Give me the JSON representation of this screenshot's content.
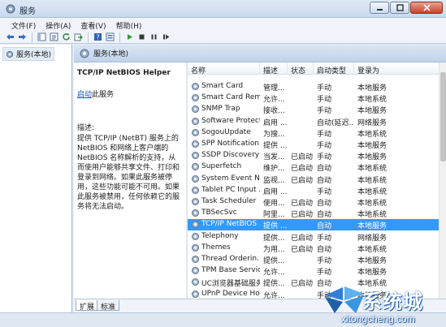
{
  "window": {
    "title": "服务"
  },
  "menu": {
    "items": [
      "文件(F)",
      "操作(A)",
      "查看(V)",
      "帮助(H)"
    ]
  },
  "toolbar": {
    "icons": [
      "back-icon",
      "forward-icon",
      "console-tree-icon",
      "properties-icon",
      "refresh-icon",
      "export-icon",
      "help-icon",
      "details-icon",
      "play-icon",
      "stop-icon",
      "pause-icon",
      "restart-icon"
    ]
  },
  "tree": {
    "root_label": "服务(本地)"
  },
  "panel": {
    "header_title": "服务(本地)"
  },
  "details": {
    "service_name": "TCP/IP NetBIOS Helper",
    "start_link": "启动",
    "start_suffix": "此服务",
    "desc_label": "描述:",
    "desc_text": "提供 TCP/IP (NetBT) 服务上的 NetBIOS 和网络上客户端的 NetBIOS 名称解析的支持，从而使用户能够共享文件、打印和登录到网络。如果此服务被停用，这些功能可能不可用。如果此服务被禁用，任何依赖它的服务将无法启动。"
  },
  "table": {
    "columns": [
      "名称",
      "描述",
      "状态",
      "启动类型",
      "登录为"
    ],
    "rows": [
      {
        "name": "Smart Card",
        "desc": "管理...",
        "status": "",
        "startup": "手动",
        "logon": "本地服务"
      },
      {
        "name": "Smart Card Rem...",
        "desc": "允许...",
        "status": "",
        "startup": "手动",
        "logon": "本地系统"
      },
      {
        "name": "SNMP Trap",
        "desc": "接收...",
        "status": "",
        "startup": "手动",
        "logon": "本地服务"
      },
      {
        "name": "Software Protect...",
        "desc": "启用 ...",
        "status": "",
        "startup": "自动(延迟...",
        "logon": "网络服务"
      },
      {
        "name": "SogouUpdate",
        "desc": "为搜...",
        "status": "",
        "startup": "手动",
        "logon": "本地系统"
      },
      {
        "name": "SPP Notification ...",
        "desc": "提供 ...",
        "status": "",
        "startup": "手动",
        "logon": "本地服务"
      },
      {
        "name": "SSDP Discovery",
        "desc": "当发...",
        "status": "已启动",
        "startup": "手动",
        "logon": "本地服务"
      },
      {
        "name": "Superfetch",
        "desc": "维护...",
        "status": "已启动",
        "startup": "自动",
        "logon": "本地系统"
      },
      {
        "name": "System Event N...",
        "desc": "监视...",
        "status": "已启动",
        "startup": "自动",
        "logon": "本地系统"
      },
      {
        "name": "Tablet PC Input ...",
        "desc": "启用 ...",
        "status": "",
        "startup": "手动",
        "logon": "本地系统"
      },
      {
        "name": "Task Scheduler",
        "desc": "使用...",
        "status": "已启动",
        "startup": "自动",
        "logon": "本地系统"
      },
      {
        "name": "TBSecSvc",
        "desc": "阿里...",
        "status": "已启动",
        "startup": "自动",
        "logon": "本地系统"
      },
      {
        "name": "TCP/IP NetBIOS ...",
        "desc": "提供 ...",
        "status": "",
        "startup": "自动",
        "logon": "本地服务"
      },
      {
        "name": "Telephony",
        "desc": "提供...",
        "status": "已启动",
        "startup": "手动",
        "logon": "网络服务"
      },
      {
        "name": "Themes",
        "desc": "为用...",
        "status": "已启动",
        "startup": "自动",
        "logon": "本地系统"
      },
      {
        "name": "Thread Orderin...",
        "desc": "提供...",
        "status": "",
        "startup": "手动",
        "logon": "本地服务"
      },
      {
        "name": "TPM Base Servic...",
        "desc": "允许...",
        "status": "",
        "startup": "手动",
        "logon": "本地服务"
      },
      {
        "name": "UC浏览器基础服务",
        "desc": "提供...",
        "status": "已启动",
        "startup": "自动",
        "logon": "本地系统"
      },
      {
        "name": "UPnP Device Host",
        "desc": "允许...",
        "status": "",
        "startup": "手动",
        "logon": "本地服务"
      }
    ],
    "selected_index": 12
  },
  "tabs": {
    "extended": "扩展",
    "standard": "标准"
  },
  "watermark": {
    "brand": "系统城",
    "domain": "xitongcheng.com"
  },
  "colors": {
    "selection": "#3399ff",
    "link": "#0b56c4"
  }
}
